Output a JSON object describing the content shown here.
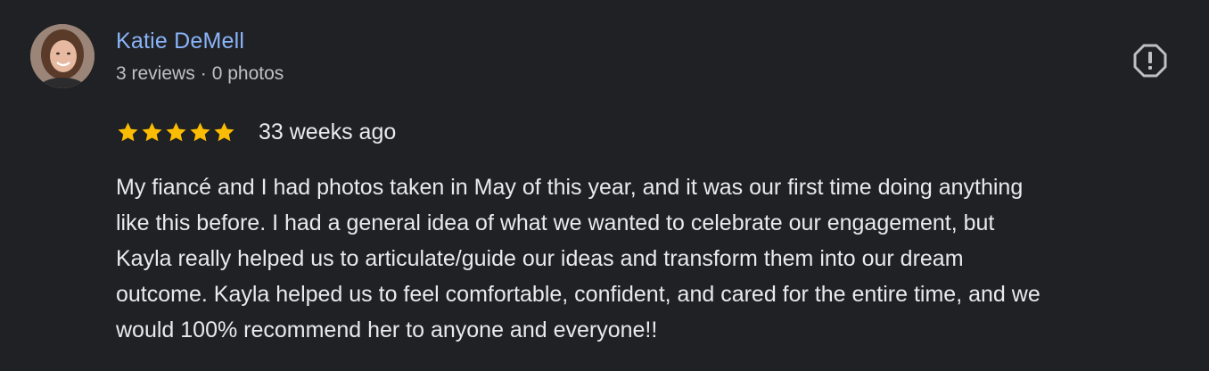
{
  "review": {
    "author": {
      "name": "Katie DeMell",
      "reviews_count": "3 reviews",
      "separator": "·",
      "photos_count": "0 photos",
      "avatar_icon": "user-photo-avatar"
    },
    "flag_icon": "report-octagon-icon",
    "rating": {
      "stars": 5,
      "max": 5,
      "star_color": "#fbbc04"
    },
    "date": "33 weeks ago",
    "text_lines": [
      "My fiancé and I had photos taken in May of this year, and it was our first time doing anything",
      "like this before. I had a general idea of what we wanted to celebrate our engagement, but",
      "Kayla really helped us to articulate/guide our ideas and transform them into our dream",
      "outcome. Kayla helped us to feel comfortable, confident, and cared for the entire time, and we",
      "would 100% recommend her to anyone and everyone!!"
    ]
  },
  "colors": {
    "background": "#202124",
    "name": "#8ab4f8",
    "meta": "#bdc1c6",
    "text": "#e8eaed",
    "icon": "#bdc1c6"
  }
}
